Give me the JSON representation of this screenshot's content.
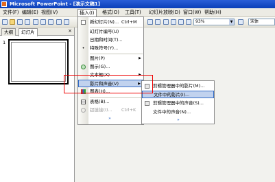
{
  "window": {
    "title": "Microsoft PowerPoint - [演示文稿1]"
  },
  "menubar": [
    "文件(F)",
    "编辑(E)",
    "视图(V)",
    "插入(I)",
    "格式(O)",
    "工具(T)",
    "幻灯片放映(D)",
    "窗口(W)",
    "帮助(H)"
  ],
  "toolbar": {
    "zoom": "93%",
    "font": "宋体"
  },
  "panel": {
    "tabs": [
      "大纲",
      "幻灯片"
    ],
    "close": "×",
    "slide_number": "1"
  },
  "insert_menu": {
    "items": [
      {
        "label": "新幻灯片(N)...",
        "shortcut": "Ctrl+M",
        "icon": "new-slide-icon"
      },
      {
        "label": "幻灯片编号(U)",
        "icon": ""
      },
      {
        "label": "日期和时间(T)...",
        "icon": ""
      },
      {
        "label": "特殊符号(Y)...",
        "icon": "special-symbol-icon"
      },
      {
        "label": "图片(P)",
        "icon": "",
        "submenu": true
      },
      {
        "label": "图示(G)...",
        "icon": "diagram-icon"
      },
      {
        "label": "文本框(X)",
        "icon": "",
        "submenu": true
      },
      {
        "label": "影片和声音(V)",
        "icon": "",
        "submenu": true,
        "highlighted": true
      },
      {
        "label": "图表(H)...",
        "icon": "chart-icon"
      },
      {
        "label": "表格(B)...",
        "icon": "table-icon"
      },
      {
        "label": "超链接(I)...",
        "shortcut": "Ctrl+K",
        "icon": "hyperlink-icon",
        "disabled": true
      }
    ],
    "expand": "»"
  },
  "movie_submenu": {
    "items": [
      {
        "label": "剪辑管理器中的影片(M)..."
      },
      {
        "label": "文件中的影片(I)...",
        "highlighted": true
      },
      {
        "label": "剪辑管理器中的声音(S)..."
      },
      {
        "label": "文件中的声音(N)..."
      }
    ],
    "expand": "»"
  }
}
